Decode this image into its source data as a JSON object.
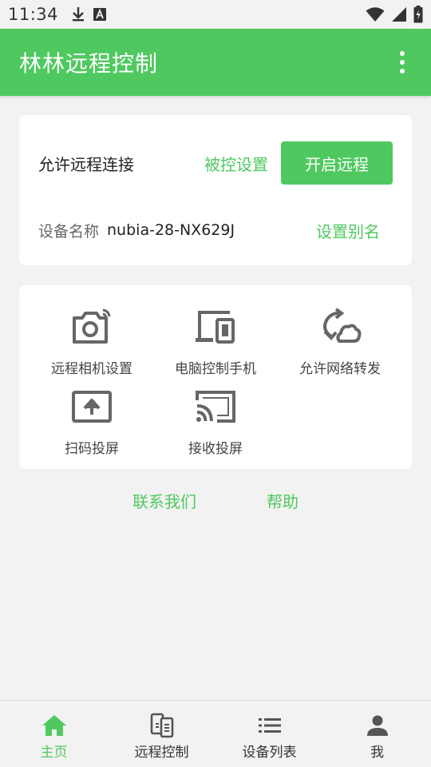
{
  "status_bar": {
    "time": "11:34",
    "icons": [
      "download-icon",
      "a-notification-icon",
      "wifi-icon",
      "signal-icon",
      "battery-charging-icon"
    ]
  },
  "app_bar": {
    "title": "林林远程控制",
    "menu_icon": "more-vert-icon"
  },
  "remote_card": {
    "allow_label": "允许远程连接",
    "controlled_settings_link": "被控设置",
    "start_button": "开启远程",
    "device_name_label": "设备名称",
    "device_name_value": "nubia-28-NX629J",
    "set_alias_link": "设置别名"
  },
  "features": [
    {
      "label": "远程相机设置",
      "icon": "camera-icon"
    },
    {
      "label": "电脑控制手机",
      "icon": "devices-icon"
    },
    {
      "label": "允许网络转发",
      "icon": "network-forward-icon"
    },
    {
      "label": "扫码投屏",
      "icon": "screen-upload-icon"
    },
    {
      "label": "接收投屏",
      "icon": "cast-icon"
    }
  ],
  "footer_links": {
    "contact": "联系我们",
    "help": "帮助"
  },
  "bottom_nav": [
    {
      "label": "主页",
      "icon": "home-icon",
      "active": true
    },
    {
      "label": "远程控制",
      "icon": "remote-control-icon",
      "active": false
    },
    {
      "label": "设备列表",
      "icon": "list-icon",
      "active": false
    },
    {
      "label": "我",
      "icon": "person-icon",
      "active": false
    }
  ],
  "colors": {
    "accent": "#4fc95f",
    "background": "#f2f2f2",
    "icon_gray": "#666666"
  }
}
